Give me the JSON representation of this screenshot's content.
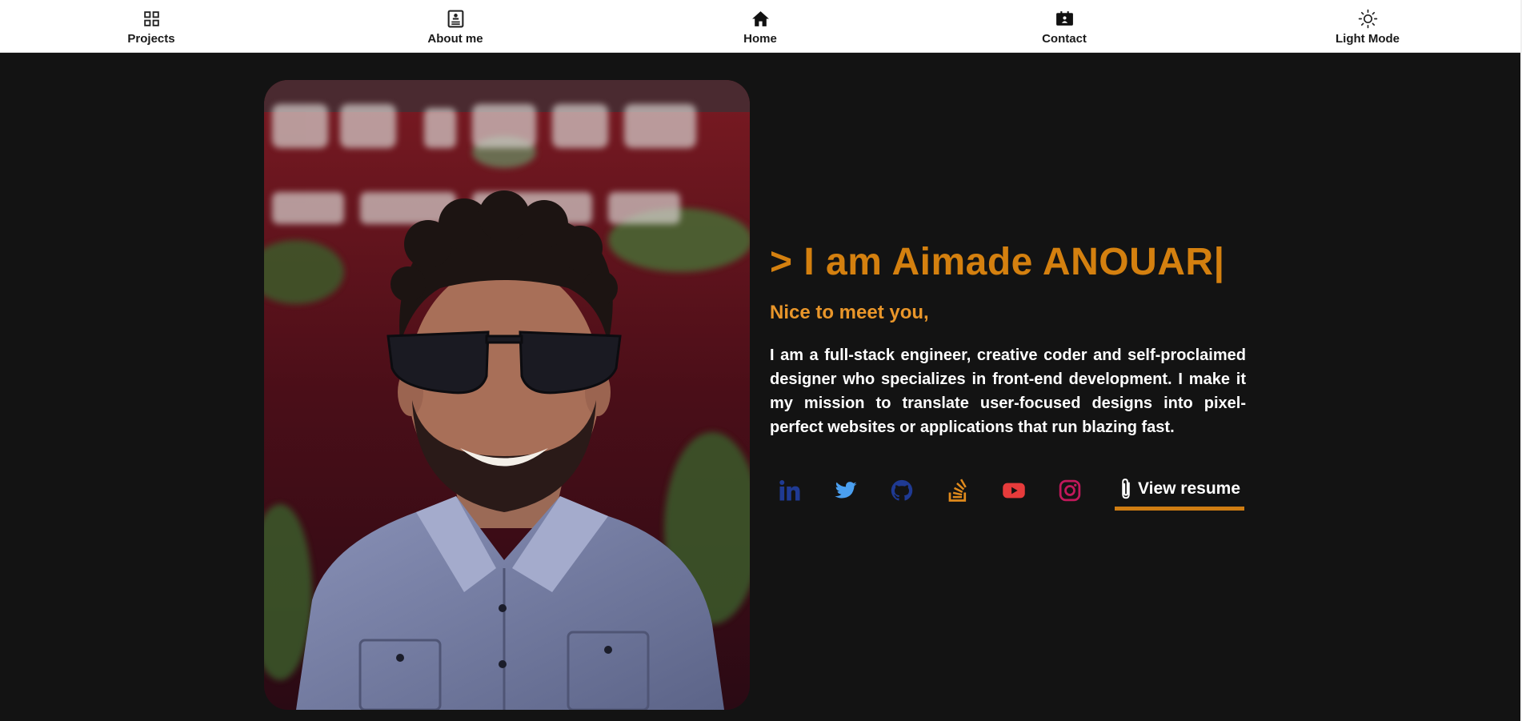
{
  "nav": {
    "items": [
      {
        "label": "Projects",
        "icon": "grid-icon"
      },
      {
        "label": "About me",
        "icon": "profile-card-icon"
      },
      {
        "label": "Home",
        "icon": "home-icon"
      },
      {
        "label": "Contact",
        "icon": "contact-card-icon"
      },
      {
        "label": "Light Mode",
        "icon": "sun-icon"
      }
    ]
  },
  "hero": {
    "photo_alt": "Portrait photo",
    "headline": "> I am Aimade ANOUAR|",
    "subtitle": "Nice to meet you,",
    "bio": "I am a full-stack engineer, creative coder and self-proclaimed designer who specializes in front-end development. I make it my mission to translate user-focused designs into pixel-perfect websites or applications that run blazing fast.",
    "social": [
      {
        "name": "linkedin-icon",
        "color": "#1f3a93"
      },
      {
        "name": "twitter-icon",
        "color": "#4a9ff0"
      },
      {
        "name": "github-icon",
        "color": "#1f3a93"
      },
      {
        "name": "stackoverflow-icon",
        "color": "#e08a1c"
      },
      {
        "name": "youtube-icon",
        "color": "#e63b3b"
      },
      {
        "name": "instagram-icon",
        "color": "#c2185b"
      }
    ],
    "resume_label": "View resume"
  },
  "colors": {
    "background": "#131313",
    "accent": "#d4800f",
    "nav_bg": "#ffffff"
  }
}
